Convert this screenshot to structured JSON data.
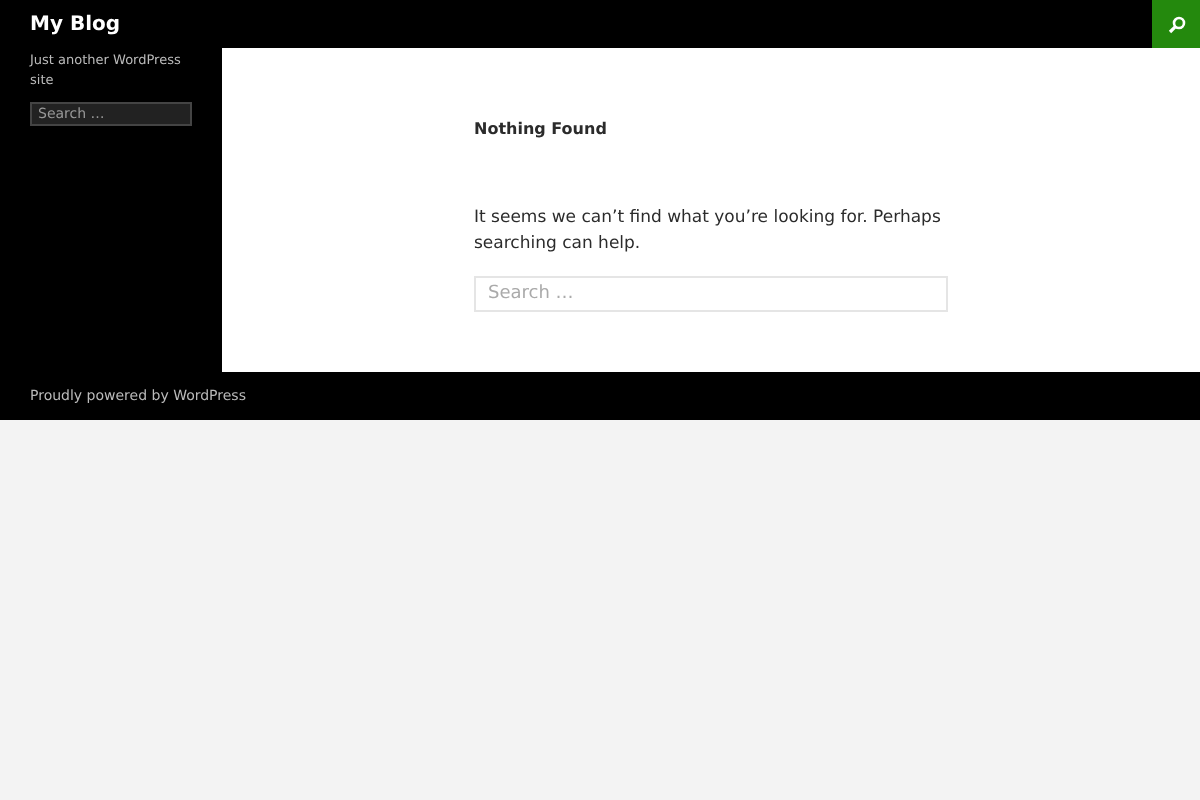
{
  "header": {
    "site_title": "My Blog"
  },
  "sidebar": {
    "description": "Just another WordPress site",
    "search": {
      "placeholder": "Search …"
    }
  },
  "content": {
    "title": "Nothing Found",
    "message": "It seems we can’t find what you’re looking for. Perhaps searching can help.",
    "search": {
      "placeholder": "Search …"
    }
  },
  "footer": {
    "credit": "Proudly powered by WordPress"
  }
}
